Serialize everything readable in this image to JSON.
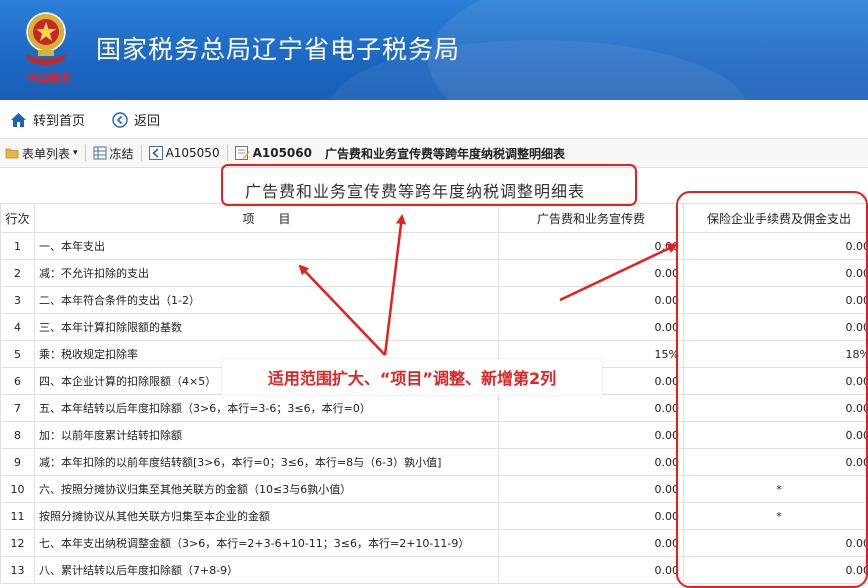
{
  "banner": {
    "title": "国家税务总局辽宁省电子税务局",
    "emblem_caption": "中国税务"
  },
  "nav": {
    "home_label": "转到首页",
    "back_label": "返回"
  },
  "toolbar": {
    "form_list_label": "表单列表",
    "freeze_label": "冻结",
    "prev_code": "A105050",
    "current_code": "A105060",
    "current_title": "广告费和业务宣传费等跨年度纳税调整明细表"
  },
  "sheet": {
    "title": "广告费和业务宣传费等跨年度纳税调整明细表",
    "headers": {
      "row_no": "行次",
      "item": "项　　目",
      "col1": "广告费和业务宣传费",
      "col2": "保险企业手续费及佣金支出"
    },
    "rows": [
      {
        "no": "1",
        "item": "一、本年支出",
        "v1": "0.00",
        "v2": "0.00"
      },
      {
        "no": "2",
        "item": "减：不允许扣除的支出",
        "v1": "0.00",
        "v2": "0.00"
      },
      {
        "no": "3",
        "item": "二、本年符合条件的支出（1-2）",
        "v1": "0.00",
        "v2": "0.00"
      },
      {
        "no": "4",
        "item": "三、本年计算扣除限额的基数",
        "v1": "0.00",
        "v2": "0.00"
      },
      {
        "no": "5",
        "item": "乘：税收规定扣除率",
        "v1": "15%",
        "v2": "18%"
      },
      {
        "no": "6",
        "item": "四、本企业计算的扣除限额（4×5）",
        "v1": "0.00",
        "v2": "0.00"
      },
      {
        "no": "7",
        "item": "五、本年结转以后年度扣除额（3>6，本行=3-6；3≤6，本行=0）",
        "v1": "0.00",
        "v2": "0.00"
      },
      {
        "no": "8",
        "item": "加：以前年度累计结转扣除额",
        "v1": "0.00",
        "v2": "0.00"
      },
      {
        "no": "9",
        "item": "减：本年扣除的以前年度结转额[3>6，本行=0；3≤6，本行=8与（6-3）孰小值]",
        "v1": "0.00",
        "v2": "0.00"
      },
      {
        "no": "10",
        "item": "六、按照分摊协议归集至其他关联方的金额（10≤3与6孰小值）",
        "v1": "0.00",
        "v2": "*"
      },
      {
        "no": "11",
        "item": "按照分摊协议从其他关联方归集至本企业的金额",
        "v1": "0.00",
        "v2": "*"
      },
      {
        "no": "12",
        "item": "七、本年支出纳税调整金额（3>6，本行=2+3-6+10-11；3≤6，本行=2+10-11-9）",
        "v1": "0.00",
        "v2": "0.00"
      },
      {
        "no": "13",
        "item": "八、累计结转以后年度扣除额（7+8-9）",
        "v1": "0.00",
        "v2": "0.00"
      }
    ]
  },
  "annotation": {
    "callout_text": "适用范围扩大、“项目”调整、新增第2列"
  },
  "colors": {
    "banner": "#1c67c2",
    "accent_red": "#e62020"
  }
}
